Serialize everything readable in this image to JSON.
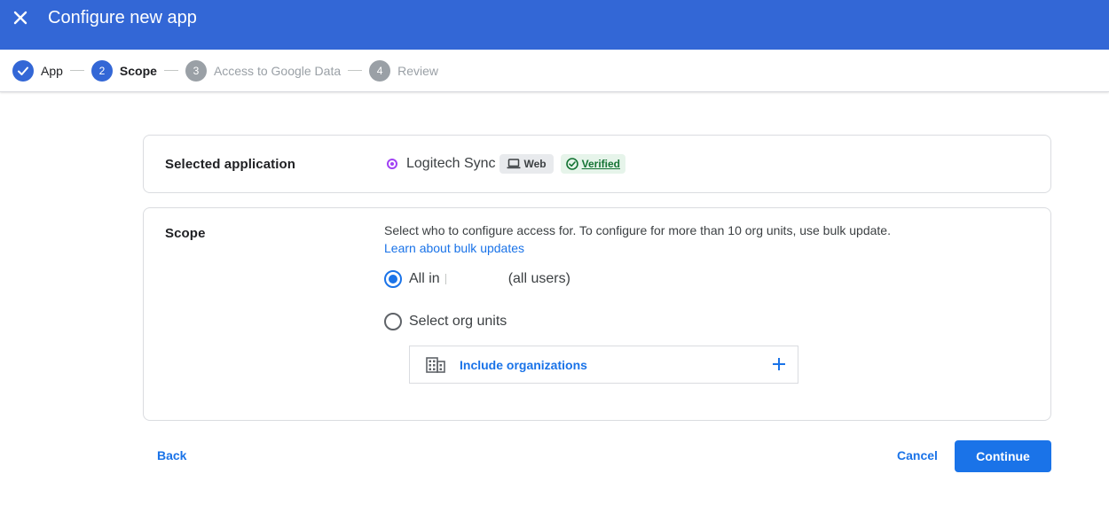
{
  "header": {
    "title": "Configure new app",
    "close_icon": "close-icon",
    "bg_color": "#3367d6"
  },
  "stepper": {
    "steps": [
      {
        "number": "1",
        "label": "App",
        "state": "done"
      },
      {
        "number": "2",
        "label": "Scope",
        "state": "active"
      },
      {
        "number": "3",
        "label": "Access to Google Data",
        "state": "todo"
      },
      {
        "number": "4",
        "label": "Review",
        "state": "todo"
      }
    ]
  },
  "selected_app": {
    "label": "Selected application",
    "app_name": "Logitech Sync",
    "platform_chip": "Web",
    "verified_chip": "Verified"
  },
  "scope": {
    "label": "Scope",
    "description": "Select who to configure access for. To configure for more than 10 org units, use bulk update.",
    "link": "Learn about bulk updates",
    "option_all_prefix": "All in",
    "option_all_suffix": "(all users)",
    "option_all_selected": true,
    "option_org": "Select org units",
    "include_label": "Include organizations"
  },
  "footer": {
    "back": "Back",
    "cancel": "Cancel",
    "continue": "Continue",
    "accent": "#1a73e8"
  }
}
